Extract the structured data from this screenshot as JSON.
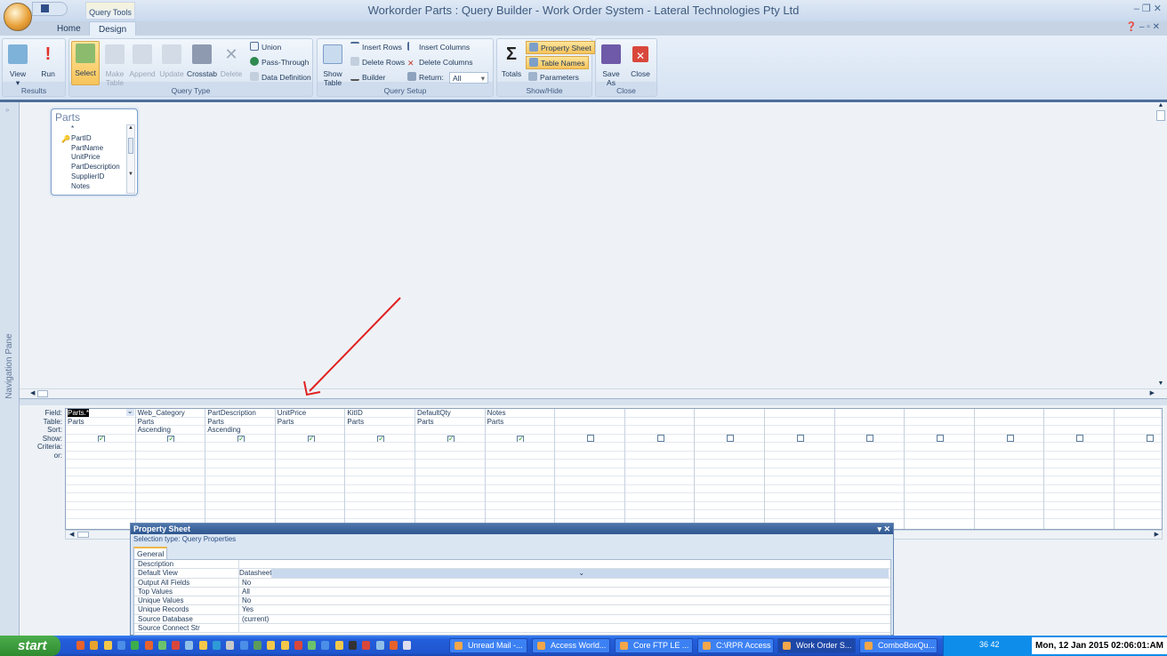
{
  "window": {
    "title": "Workorder Parts : Query Builder - Work Order System - Lateral Technologies Pty Ltd",
    "context_tab": "Query Tools"
  },
  "tabs": [
    "Home",
    "Design"
  ],
  "ribbon": {
    "results": {
      "label": "Results",
      "view": "View",
      "run": "Run"
    },
    "query_type": {
      "label": "Query Type",
      "select": "Select",
      "make_table": "Make Table",
      "append": "Append",
      "update": "Update",
      "crosstab": "Crosstab",
      "delete": "Delete",
      "union": "Union",
      "pass_through": "Pass-Through",
      "data_definition": "Data Definition"
    },
    "query_setup": {
      "label": "Query Setup",
      "show_table": "Show Table",
      "insert_rows": "Insert Rows",
      "delete_rows": "Delete Rows",
      "builder": "Builder",
      "insert_columns": "Insert Columns",
      "delete_columns": "Delete Columns",
      "return_label": "Return:",
      "return_value": "All"
    },
    "show_hide": {
      "label": "Show/Hide",
      "totals": "Totals",
      "property_sheet": "Property Sheet",
      "table_names": "Table Names",
      "parameters": "Parameters"
    },
    "close": {
      "label": "Close",
      "save_as": "Save As",
      "close": "Close"
    }
  },
  "nav_pane": {
    "label": "Navigation Pane"
  },
  "table": {
    "name": "Parts",
    "fields": [
      "*",
      "PartID",
      "PartName",
      "UnitPrice",
      "PartDescription",
      "SupplierID",
      "Notes"
    ]
  },
  "grid": {
    "row_labels": [
      "Field:",
      "Table:",
      "Sort:",
      "Show:",
      "Criteria:",
      "or:"
    ],
    "columns": [
      {
        "field": "Parts.*",
        "table": "Parts",
        "sort": "",
        "show": true
      },
      {
        "field": "Web_Category",
        "table": "Parts",
        "sort": "Ascending",
        "show": true
      },
      {
        "field": "PartDescription",
        "table": "Parts",
        "sort": "Ascending",
        "show": true
      },
      {
        "field": "UnitPrice",
        "table": "Parts",
        "sort": "",
        "show": true
      },
      {
        "field": "KitID",
        "table": "Parts",
        "sort": "",
        "show": true
      },
      {
        "field": "DefaultQty",
        "table": "Parts",
        "sort": "",
        "show": true
      },
      {
        "field": "Notes",
        "table": "Parts",
        "sort": "",
        "show": true
      },
      {
        "field": "",
        "table": "",
        "sort": "",
        "show": false
      },
      {
        "field": "",
        "table": "",
        "sort": "",
        "show": false
      },
      {
        "field": "",
        "table": "",
        "sort": "",
        "show": false
      },
      {
        "field": "",
        "table": "",
        "sort": "",
        "show": false
      },
      {
        "field": "",
        "table": "",
        "sort": "",
        "show": false
      },
      {
        "field": "",
        "table": "",
        "sort": "",
        "show": false
      },
      {
        "field": "",
        "table": "",
        "sort": "",
        "show": false
      },
      {
        "field": "",
        "table": "",
        "sort": "",
        "show": false
      },
      {
        "field": "",
        "table": "",
        "sort": "",
        "show": false
      }
    ]
  },
  "property_sheet": {
    "title": "Property Sheet",
    "selection_type": "Selection type:  Query Properties",
    "tab": "General",
    "rows": [
      [
        "Description",
        ""
      ],
      [
        "Default View",
        "Datasheet"
      ],
      [
        "Output All Fields",
        "No"
      ],
      [
        "Top Values",
        "All"
      ],
      [
        "Unique Values",
        "No"
      ],
      [
        "Unique Records",
        "Yes"
      ],
      [
        "Source Database",
        "(current)"
      ],
      [
        "Source Connect Str",
        ""
      ]
    ]
  },
  "taskbar": {
    "start": "start",
    "tasks": [
      "Unread Mail -...",
      "Access World...",
      "Core FTP LE ...",
      "C:\\RPR Access",
      "Work Order S...",
      "ComboBoxQu..."
    ],
    "tray_numbers": "36 42",
    "clock": "Mon, 12 Jan 2015  02:06:01:AM"
  },
  "colors": {
    "annotation_arrow": "#e02020",
    "accent": "#2f5790"
  }
}
